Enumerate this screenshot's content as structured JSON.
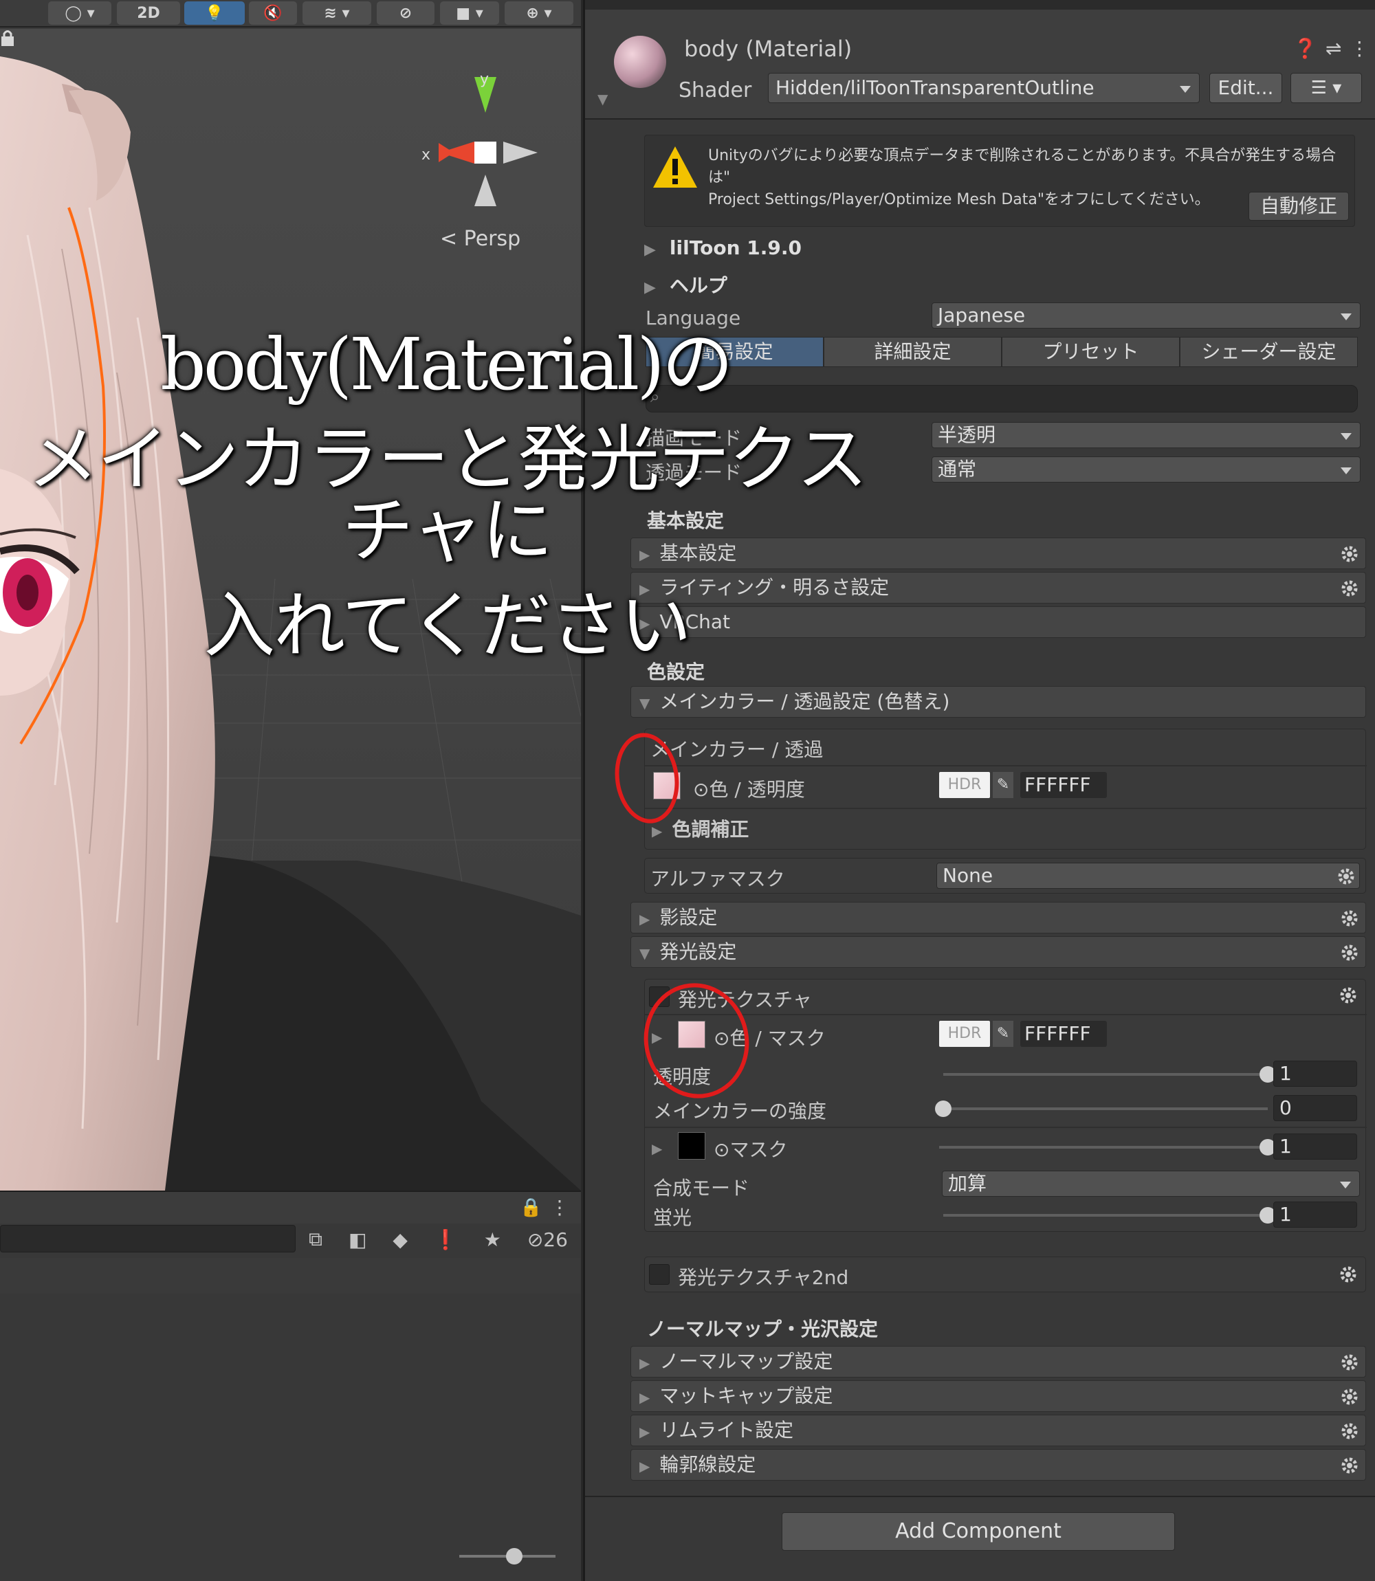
{
  "scene": {
    "toolbar": {
      "mode_2d": "2D"
    },
    "persp_label": "< Persp",
    "gizmo": {
      "x_label": "x",
      "y_label": "y"
    },
    "overlay": {
      "line1": "body(Material)の",
      "line2": "メインカラーと発光テクスチャに",
      "line3": "入れてください"
    },
    "project": {
      "hidden_count": "26"
    }
  },
  "inspector": {
    "title": "body (Material)",
    "shader_label": "Shader",
    "shader_value": "Hidden/lilToonTransparentOutline",
    "edit_button": "Edit...",
    "warning": {
      "line1": "Unityのバグにより必要な頂点データまで削除されることがあります。不具合が発生する場合は\"",
      "line2": "Project Settings/Player/Optimize Mesh Data\"をオフにしてください。",
      "autofix_button": "自動修正"
    },
    "liltoon_version": "lilToon 1.9.0",
    "help": "ヘルプ",
    "language_label": "Language",
    "language_value": "Japanese",
    "tabs": [
      "簡易設定",
      "詳細設定",
      "プリセット",
      "シェーダー設定"
    ],
    "render_mode_label": "描画モード",
    "render_mode_value": "半透明",
    "transparent_mode_label": "透過モード",
    "transparent_mode_value": "通常",
    "basic_section": "基本設定",
    "basic_rows": [
      "基本設定",
      "ライティング・明るさ設定",
      "VRChat"
    ],
    "color_section": "色設定",
    "main_color_header": "メインカラー / 透過設定 (色替え)",
    "main_color_group": {
      "title": "メインカラー / 透過",
      "color_label": "⊙色 / 透明度",
      "hdr": "HDR",
      "hex": "FFFFFF",
      "color_correction": "色調補正"
    },
    "alpha_mask": {
      "label": "アルファマスク",
      "value": "None"
    },
    "shadow_row": "影設定",
    "emission_row": "発光設定",
    "emission_group": {
      "title": "発光テクスチャ",
      "color_label": "⊙色 / マスク",
      "hdr": "HDR",
      "hex": "FFFFFF",
      "opacity_label": "透明度",
      "opacity_value": "1",
      "main_color_strength_label": "メインカラーの強度",
      "main_color_strength_value": "0",
      "mask_label": "⊙マスク",
      "mask_value": "1",
      "blend_mode_label": "合成モード",
      "blend_mode_value": "加算",
      "fluorescence_label": "蛍光",
      "fluorescence_value": "1"
    },
    "emission_2nd": "発光テクスチャ2nd",
    "normal_section": "ノーマルマップ・光沢設定",
    "normal_rows": [
      "ノーマルマップ設定",
      "マットキャップ設定",
      "リムライト設定",
      "輪郭線設定"
    ],
    "add_component": "Add Component"
  },
  "colors": {
    "accent_tab": "#46607e",
    "annotation_red": "#e01b1b",
    "warning_yellow": "#f2c200"
  },
  "slider_levels": {
    "opacity": 1,
    "main_color_strength": 0,
    "mask": 1,
    "fluorescence": 1
  }
}
